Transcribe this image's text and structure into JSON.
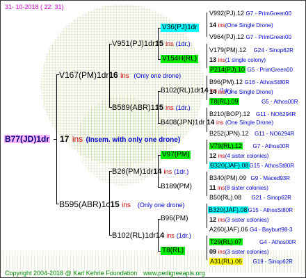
{
  "header": "31- 10-2018 ( 22: 31)",
  "footer": {
    "copyright": "Copyright 2004-2018 @ Karl Kehrle Foundation",
    "url": "www.pedigreeapis.org"
  },
  "colors": {
    "cyan": "#00ffff",
    "green": "#00ee00",
    "yellow": "#ffff00",
    "pink": "#ffb6ff"
  },
  "root": {
    "name": "B77(JD)1dr",
    "count": "17",
    "ins": "ins",
    "note": "(Insem. with only one drone)"
  },
  "gen1": [
    {
      "name": "V167(PM)1dr",
      "count": "16",
      "ins": "ins",
      "note": "(Only one drone)"
    },
    {
      "name": "B595(ABR)1c",
      "count": "15",
      "ins": "ins",
      "note": "(Only one drone)"
    }
  ],
  "gen2": [
    {
      "name": "V951(PJ)1dr",
      "count": "15",
      "ins": "ins",
      "note": "(1dr.)"
    },
    {
      "name": "B589(ABR)1",
      "count": "15",
      "ins": "ins",
      "note": "(1dr.)"
    },
    {
      "name": "B26(PM)1dr",
      "count": "14",
      "ins": "ins",
      "note": "(1dr.)"
    },
    {
      "name": "B102(RL)1dr",
      "count": "14",
      "ins": "ins",
      "note": "(1dr.)"
    }
  ],
  "gen3": [
    {
      "name": "V36(PJ)1dr",
      "count": "",
      "ins": "",
      "note": ""
    },
    {
      "name": "V154H(RL)",
      "count": "",
      "ins": "",
      "note": ""
    },
    {
      "name": "B102(RL)1dr",
      "count": "14",
      "ins": "ins",
      "note": "(1dr.)"
    },
    {
      "name": "B408(JPN)1dr",
      "count": "14",
      "ins": "ins",
      "note": "(One Single Drone)"
    },
    {
      "name": "V97(PM)",
      "count": "",
      "ins": "",
      "note": ""
    },
    {
      "name": "B189(PM)",
      "count": "",
      "ins": "",
      "note": ""
    },
    {
      "name": "B96(PM)",
      "count": "",
      "ins": "",
      "note": ""
    },
    {
      "name": "T8(RL)",
      "count": "",
      "ins": "",
      "note": ""
    }
  ],
  "gen4": [
    {
      "name": "V992(PJ).12",
      "info": "G7 - PrimGreen00"
    },
    {
      "count": "14",
      "ins": "ins",
      "note": "(One Single Drone)"
    },
    {
      "name": "V964(PJ).12",
      "info": "G7 - PrimGreen00"
    },
    {
      "name": "V179(PM).12",
      "info": "G24 - Sinop62R"
    },
    {
      "count": "13",
      "ins": "ins",
      "note": "(1 single colony)"
    },
    {
      "name": "P214(PJ).10",
      "info": "G5 - PrimGreen00"
    },
    {
      "name": "B96(PM).12",
      "info": "G16 - AthosSt80R"
    },
    {
      "count": "14",
      "ins": "ins",
      "note": "(One Single Drone)"
    },
    {
      "name": "T8(RL).09",
      "info": "G5 - Athos00R"
    },
    {
      "name": "B210(BOP).12",
      "info": "G11 - NO6294R"
    },
    {
      "name": "B252(JPN).12",
      "info": "G11 - NO6294R"
    },
    {
      "name": "V79(RL).12",
      "info": "G7 - Athos00R"
    },
    {
      "count": "12",
      "ins": "ins",
      "note": "(4 sister colonies)"
    },
    {
      "name": "B320(JAF).08",
      "info": "G15 - AthosSt80R"
    },
    {
      "name": "B340(PM).09",
      "info": "G9 - Maced93R"
    },
    {
      "count": "11",
      "ins": "ins",
      "note": "(8 sister colonies)"
    },
    {
      "name": "B50(RL).08",
      "info": "G21 - Sinop62R"
    },
    {
      "name": "B320(JAF).08",
      "info": "G15 - AthosSt80R"
    },
    {
      "count": "12",
      "ins": "ins",
      "note": "(3 sister colonies)"
    },
    {
      "name": "A260(JAF).06",
      "info": "G4 - Bayburt98-3"
    },
    {
      "name": "T29(RL).07",
      "info": "G4 - Athos00R"
    },
    {
      "count": "09",
      "ins": "ins",
      "note": "(3 sister colonies)"
    },
    {
      "name": "A31(RL).06",
      "info": "G19 - Sinop62R"
    }
  ]
}
